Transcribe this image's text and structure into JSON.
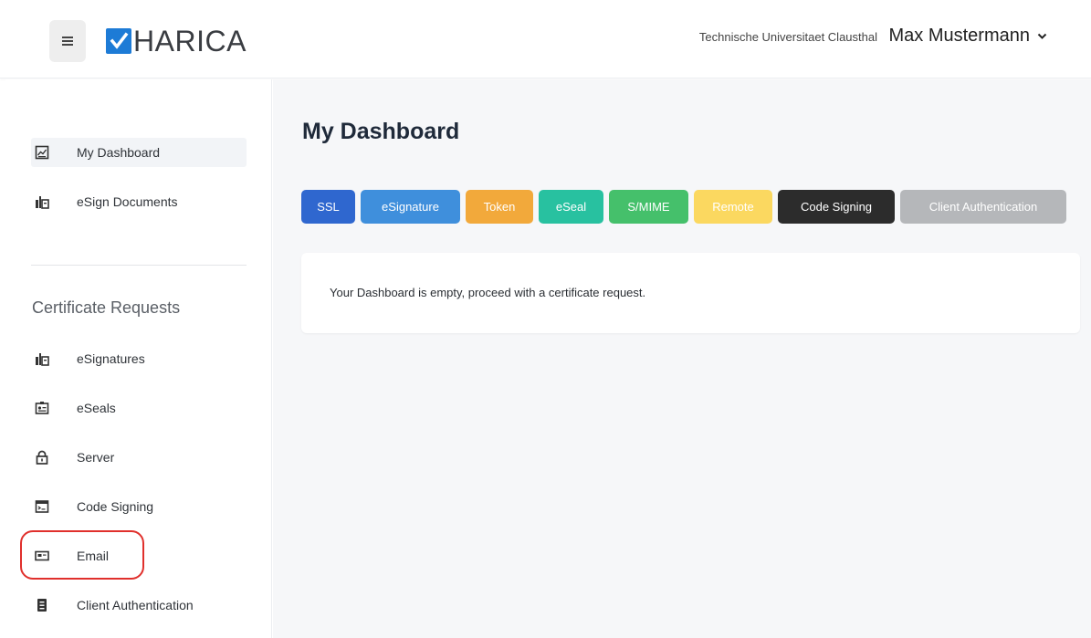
{
  "header": {
    "logo_text": "HARICA",
    "organization": "Technische Universitaet Clausthal",
    "user_name": "Max Mustermann"
  },
  "sidebar": {
    "top_items": [
      {
        "label": "My Dashboard",
        "icon": "dashboard-icon",
        "active": true
      },
      {
        "label": "eSign Documents",
        "icon": "esign-icon",
        "active": false
      }
    ],
    "section_heading": "Certificate Requests",
    "request_items": [
      {
        "label": "eSignatures",
        "icon": "esign-icon"
      },
      {
        "label": "eSeals",
        "icon": "eseal-icon"
      },
      {
        "label": "Server",
        "icon": "lock-icon"
      },
      {
        "label": "Code Signing",
        "icon": "code-window-icon"
      },
      {
        "label": "Email",
        "icon": "email-card-icon",
        "highlighted": true
      },
      {
        "label": "Client Authentication",
        "icon": "client-badge-icon"
      }
    ]
  },
  "main": {
    "title": "My Dashboard",
    "filter_chips": [
      {
        "label": "SSL",
        "color": "#2f67cf"
      },
      {
        "label": "eSignature",
        "color": "#3f8fdc"
      },
      {
        "label": "Token",
        "color": "#f2a93b"
      },
      {
        "label": "eSeal",
        "color": "#28c1a0"
      },
      {
        "label": "S/MIME",
        "color": "#45c06b"
      },
      {
        "label": "Remote",
        "color": "#fbd860"
      },
      {
        "label": "Code Signing",
        "color": "#2c2c2c"
      },
      {
        "label": "Client Authentication",
        "color": "#b5b7ba"
      }
    ],
    "empty_message": "Your Dashboard is empty, proceed with a certificate request."
  },
  "colors": {
    "highlight_ring": "#e0302c",
    "logo_blue": "#1d7bd6"
  }
}
